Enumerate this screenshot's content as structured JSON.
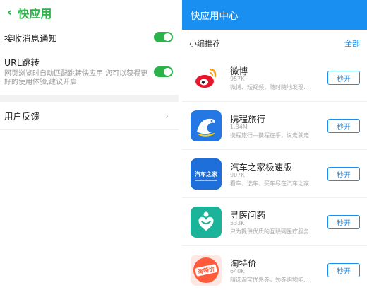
{
  "left": {
    "title": "快应用",
    "settings": {
      "notify": {
        "label": "接收消息通知",
        "on": true
      },
      "url": {
        "label": "URL跳转",
        "desc": "网页浏览时自动匹配跳转快应用,您可以获得更好的使用体验,建议开启",
        "on": true
      },
      "feedback": {
        "label": "用户反馈"
      }
    }
  },
  "right": {
    "title": "快应用中心",
    "section_title": "小编推荐",
    "section_all": "全部",
    "apps": [
      {
        "name": "微博",
        "size": "957K",
        "desc": "微博、短视频，随时随地发现...",
        "button": "秒开",
        "icon": "weibo-icon",
        "icon_text": ""
      },
      {
        "name": "携程旅行",
        "size": "1.34M",
        "desc": "携程旅行—携程在手，说走就走",
        "button": "秒开",
        "icon": "ctrip-icon",
        "icon_text": ""
      },
      {
        "name": "汽车之家极速版",
        "size": "907K",
        "desc": "看车、选车、买车尽在汽车之家",
        "button": "秒开",
        "icon": "autohome-icon",
        "icon_text": "汽车之家"
      },
      {
        "name": "寻医问药",
        "size": "533K",
        "desc": "只为提供优质的互联网医疗服务",
        "button": "秒开",
        "icon": "medical-icon",
        "icon_text": ""
      },
      {
        "name": "淘特价",
        "size": "640K",
        "desc": "精选淘宝优惠券，领券购物能...",
        "button": "秒开",
        "icon": "taotejia-icon",
        "icon_text": "淘特价"
      }
    ]
  },
  "colors": {
    "green": "#2bb34a",
    "blue": "#1a8ff2"
  }
}
